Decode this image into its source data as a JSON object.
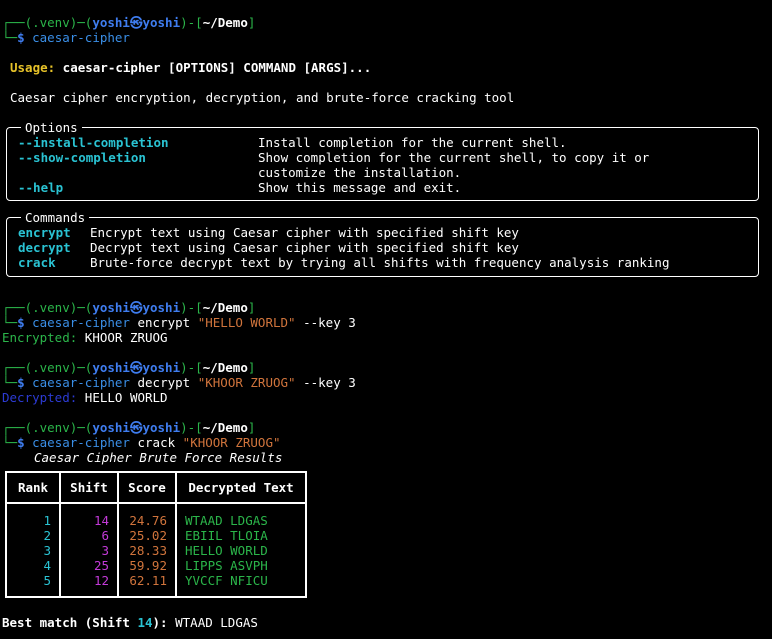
{
  "prompt": {
    "venv": "(.venv)",
    "user": "yoshi",
    "at": "㉿",
    "host": "yoshi",
    "path": "~/Demo",
    "dollar": "$"
  },
  "cmd1": "caesar-cipher",
  "usage": {
    "label": "Usage:",
    "text": " caesar-cipher [OPTIONS] COMMAND [ARGS]..."
  },
  "description": "Caesar cipher encryption, decryption, and brute-force cracking tool",
  "options_box": {
    "title": "Options",
    "items": [
      {
        "flag": "--install-completion",
        "desc": "Install completion for the current shell."
      },
      {
        "flag": "--show-completion",
        "desc": "Show completion for the current shell, to copy it or"
      },
      {
        "flag": "",
        "desc": "customize the installation."
      },
      {
        "flag": "--help",
        "desc": "Show this message and exit."
      }
    ]
  },
  "commands_box": {
    "title": "Commands",
    "items": [
      {
        "name": "encrypt",
        "desc": "Encrypt text using Caesar cipher with specified shift key"
      },
      {
        "name": "decrypt",
        "desc": "Decrypt text using Caesar cipher with specified shift key"
      },
      {
        "name": "crack",
        "desc": "Brute-force decrypt text by trying all shifts with frequency analysis ranking"
      }
    ]
  },
  "encrypt_run": {
    "program": "caesar-cipher",
    "sub": "encrypt",
    "arg": "\"HELLO WORLD\"",
    "flag": "--key",
    "key": "3",
    "out_label": "Encrypted:",
    "out_value": "KHOOR ZRUOG"
  },
  "decrypt_run": {
    "program": "caesar-cipher",
    "sub": "decrypt",
    "arg": "\"KHOOR ZRUOG\"",
    "flag": "--key",
    "key": "3",
    "out_label": "Decrypted:",
    "out_value": "HELLO WORLD"
  },
  "crack_run": {
    "program": "caesar-cipher",
    "sub": "crack",
    "arg": "\"KHOOR ZRUOG\"",
    "table_title": "Caesar Cipher Brute Force Results",
    "headers": [
      "Rank",
      "Shift",
      "Score",
      "Decrypted Text"
    ],
    "rows": [
      {
        "rank": "1",
        "shift": "14",
        "score": "24.76",
        "text": "WTAAD LDGAS"
      },
      {
        "rank": "2",
        "shift": "6",
        "score": "25.02",
        "text": "EBIIL TLOIA"
      },
      {
        "rank": "3",
        "shift": "3",
        "score": "28.33",
        "text": "HELLO WORLD"
      },
      {
        "rank": "4",
        "shift": "25",
        "score": "59.92",
        "text": "LIPPS ASVPH"
      },
      {
        "rank": "5",
        "shift": "12",
        "score": "62.11",
        "text": "YVCCF NFICU"
      }
    ],
    "best_label": "Best match (Shift ",
    "best_shift": "14",
    "best_close": "):",
    "best_text": " WTAAD LDGAS"
  }
}
